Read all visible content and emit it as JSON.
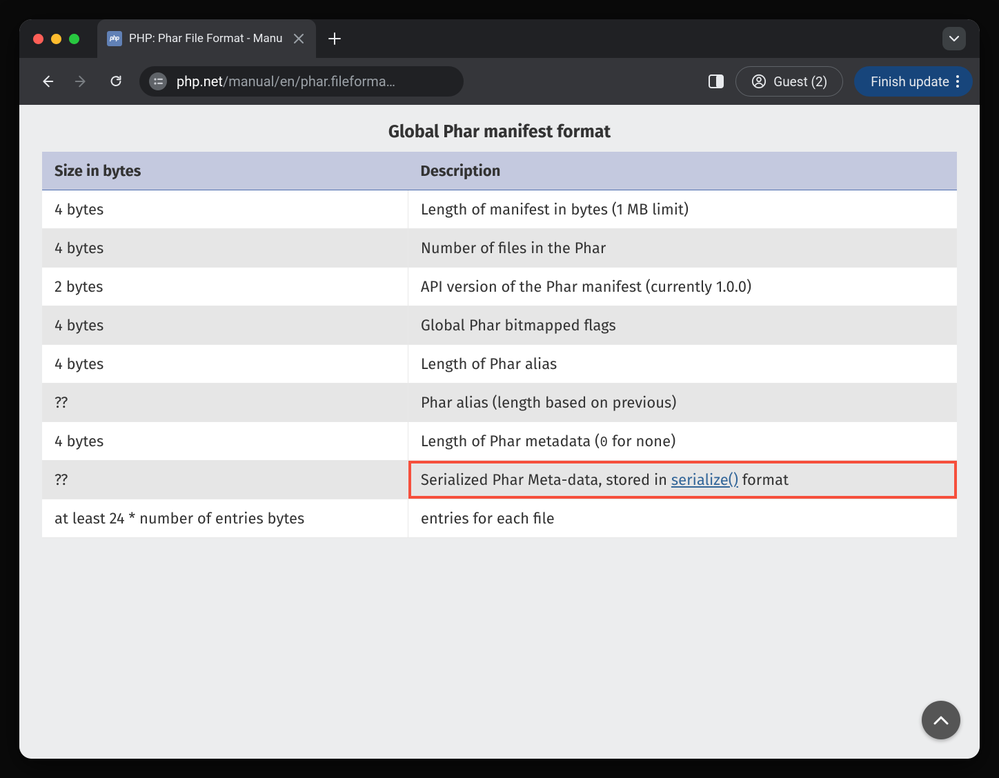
{
  "browser": {
    "tab_title": "PHP: Phar File Format - Manu",
    "favicon_label": "php",
    "url_domain": "php.net",
    "url_path": "/manual/en/phar.fileforma…",
    "guest_label": "Guest (2)",
    "finish_update_label": "Finish update"
  },
  "content": {
    "table_caption": "Global Phar manifest format",
    "headers": {
      "size": "Size in bytes",
      "description": "Description"
    },
    "rows": [
      {
        "size": "4 bytes",
        "desc": "Length of manifest in bytes (1 MB limit)"
      },
      {
        "size": "4 bytes",
        "desc": "Number of files in the Phar"
      },
      {
        "size": "2 bytes",
        "desc": "API version of the Phar manifest (currently 1.0.0)"
      },
      {
        "size": "4 bytes",
        "desc": "Global Phar bitmapped flags"
      },
      {
        "size": "4 bytes",
        "desc": "Length of Phar alias"
      },
      {
        "size": "??",
        "desc": "Phar alias (length based on previous)"
      },
      {
        "size": "4 bytes",
        "desc_prefix": "Length of Phar metadata (",
        "desc_mono": "0",
        "desc_suffix": " for none)"
      },
      {
        "size": "??",
        "desc_prefix": "Serialized Phar Meta-data, stored in ",
        "desc_link": "serialize()",
        "desc_suffix": " format",
        "highlight": true
      },
      {
        "size": "at least 24 * number of entries bytes",
        "desc": "entries for each file"
      }
    ]
  }
}
